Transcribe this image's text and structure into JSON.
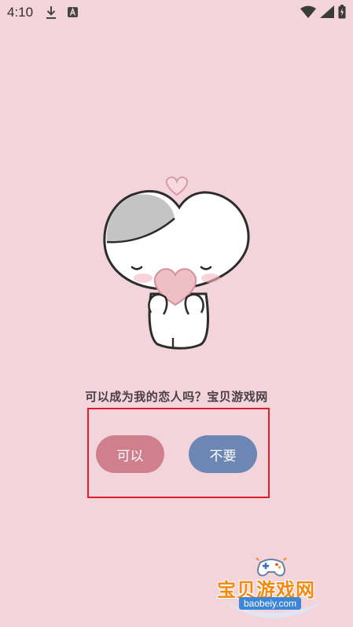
{
  "status_bar": {
    "time": "4:10",
    "icons": [
      "download-icon",
      "app-a-icon",
      "wifi-icon",
      "signal-icon",
      "battery-icon"
    ]
  },
  "main": {
    "mascot": "heart-mascot-illustration",
    "question": "可以成为我的恋人吗？宝贝游戏网",
    "buttons": {
      "yes_label": "可以",
      "no_label": "不要"
    }
  },
  "watermark": {
    "title": "宝贝游戏网",
    "url": "baobeiy.com"
  },
  "colors": {
    "background": "#f2d4da",
    "yes_button": "#d07f8d",
    "no_button": "#6c87b3",
    "highlight_border": "#d9212b",
    "watermark_orange": "#f28a12",
    "watermark_blue": "#3b86d6"
  }
}
